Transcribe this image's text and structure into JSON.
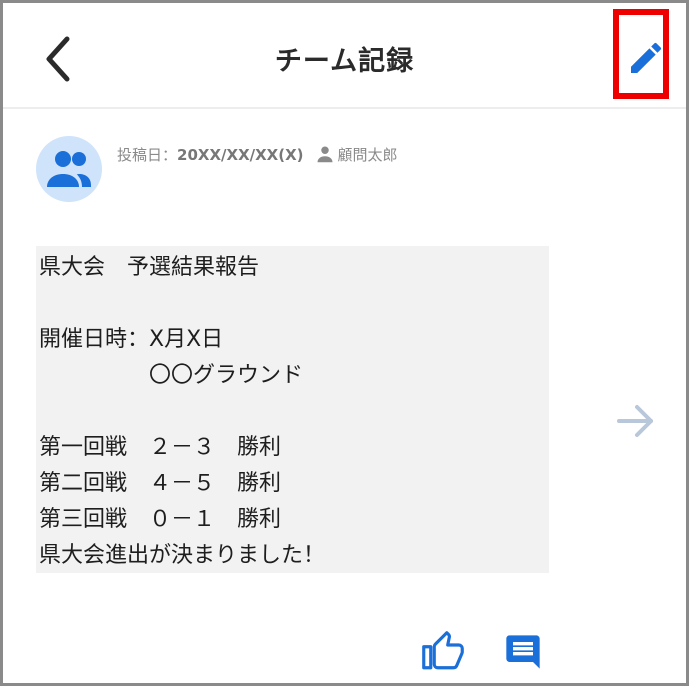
{
  "header": {
    "title": "チーム記録",
    "back_icon": "chevron-left-icon",
    "edit_icon": "pencil-icon",
    "highlight_color": "#ee0000"
  },
  "post": {
    "avatar_icon": "group-icon",
    "date_label": "投稿日：",
    "date_value": "20XX/XX/XX(X)",
    "author_icon": "person-icon",
    "author": "顧問太郎",
    "body": "県大会　予選結果報告\n\n開催日時：X月X日\n　　　　　〇〇グラウンド\n\n第一回戦　２－３　勝利\n第二回戦　４－５　勝利\n第三回戦　０－１　勝利\n県大会進出が決まりました！"
  },
  "actions": {
    "next_icon": "arrow-right-icon",
    "like_icon": "thumbs-up-icon",
    "comment_icon": "comment-icon"
  },
  "colors": {
    "accent": "#1a6fd8",
    "avatar_bg": "#cfe3fb",
    "next_arrow": "#b8c7da"
  }
}
